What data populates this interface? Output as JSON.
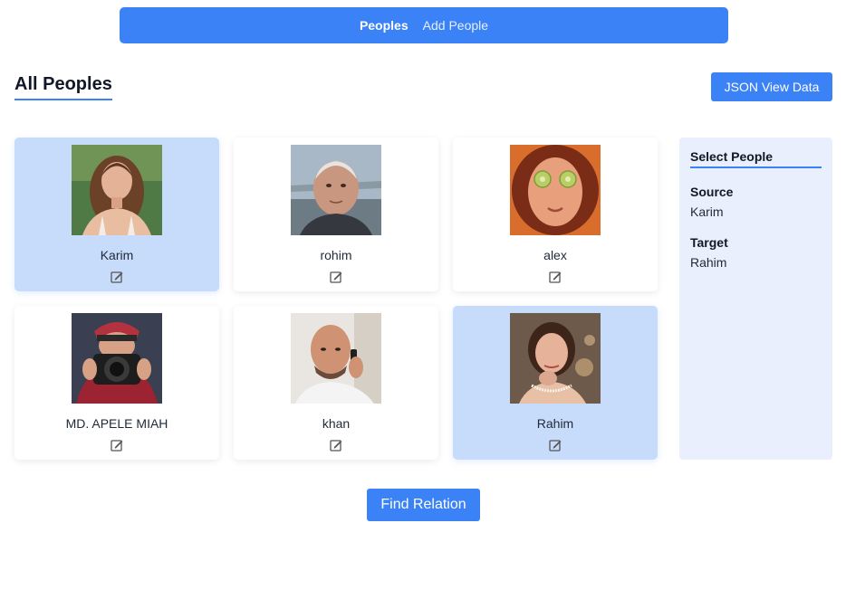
{
  "nav": {
    "items": [
      {
        "label": "Peoples",
        "active": true
      },
      {
        "label": "Add People",
        "active": false
      }
    ]
  },
  "page": {
    "title": "All Peoples",
    "json_button": "JSON View Data",
    "find_button": "Find Relation"
  },
  "people": [
    {
      "name": "Karim",
      "selected": true,
      "photo": "woman-portrait"
    },
    {
      "name": "rohim",
      "selected": false,
      "photo": "elderly-man-portrait"
    },
    {
      "name": "alex",
      "selected": false,
      "photo": "woman-cucumber-eyes"
    },
    {
      "name": "MD. APELE MIAH",
      "selected": false,
      "photo": "photographer-with-camera"
    },
    {
      "name": "khan",
      "selected": false,
      "photo": "bald-man-on-phone"
    },
    {
      "name": "Rahim",
      "selected": true,
      "photo": "woman-with-pearls"
    }
  ],
  "panel": {
    "title": "Select People",
    "source_label": "Source",
    "source_value": "Karim",
    "target_label": "Target",
    "target_value": "Rahim"
  },
  "colors": {
    "accent": "#3b82f6",
    "selected_card": "#c7dbfb",
    "panel_bg": "#e9effc"
  }
}
